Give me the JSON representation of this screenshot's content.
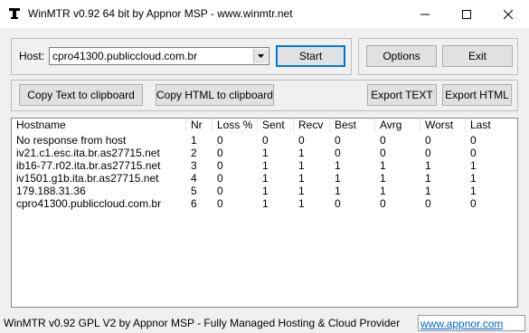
{
  "window": {
    "title": "WinMTR v0.92 64 bit by Appnor MSP - www.winmtr.net"
  },
  "host": {
    "label": "Host:",
    "value": "cpro41300.publiccloud.com.br"
  },
  "buttons": {
    "start": "Start",
    "options": "Options",
    "exit": "Exit",
    "copy_text": "Copy Text to clipboard",
    "copy_html": "Copy HTML to clipboard",
    "export_text": "Export TEXT",
    "export_html": "Export HTML"
  },
  "table": {
    "columns": [
      "Hostname",
      "Nr",
      "Loss %",
      "Sent",
      "Recv",
      "Best",
      "Avrg",
      "Worst",
      "Last"
    ],
    "rows": [
      [
        "No response from host",
        "1",
        "0",
        "0",
        "0",
        "0",
        "0",
        "0",
        "0"
      ],
      [
        "iv21.c1.esc.ita.br.as27715.net",
        "2",
        "0",
        "1",
        "1",
        "0",
        "0",
        "0",
        "0"
      ],
      [
        "ib16-77.r02.ita.br.as27715.net",
        "3",
        "0",
        "1",
        "1",
        "1",
        "1",
        "1",
        "1"
      ],
      [
        "iv1501.g1b.ita.br.as27715.net",
        "4",
        "0",
        "1",
        "1",
        "1",
        "1",
        "1",
        "1"
      ],
      [
        "179.188.31.36",
        "5",
        "0",
        "1",
        "1",
        "1",
        "1",
        "1",
        "1"
      ],
      [
        "cpro41300.publiccloud.com.br",
        "6",
        "0",
        "1",
        "1",
        "0",
        "0",
        "0",
        "0"
      ]
    ]
  },
  "status": {
    "text": "WinMTR v0.92 GPL V2 by Appnor MSP - Fully Managed Hosting & Cloud Provider",
    "link": "www.appnor.com"
  }
}
